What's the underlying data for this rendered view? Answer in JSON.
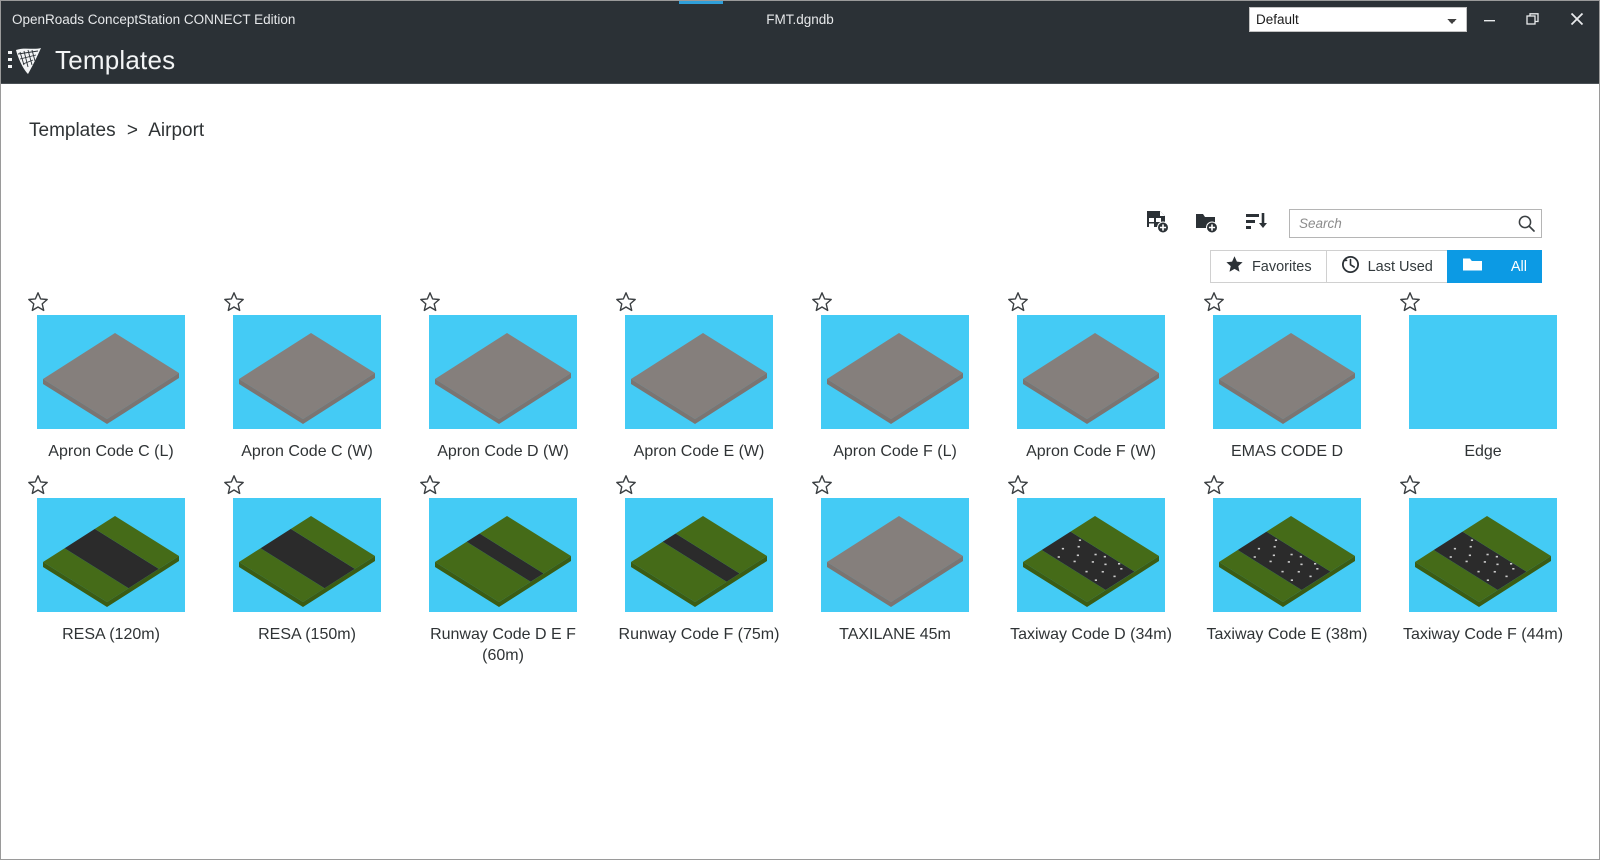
{
  "titlebar": {
    "app_name": "OpenRoads ConceptStation CONNECT Edition",
    "document_name": "FMT.dgndb",
    "profile_selected": "Default",
    "profile_options": [
      "Default"
    ],
    "minimize_label": "Minimize",
    "restore_label": "Restore",
    "close_label": "Close",
    "accent_color": "#2f9fda",
    "background_color": "#2b3136"
  },
  "header": {
    "title": "Templates",
    "logo_icon": "template-flag-icon"
  },
  "breadcrumb": {
    "root": "Templates",
    "separator": ">",
    "current": "Airport"
  },
  "toolbar": {
    "icons": [
      {
        "name": "new-template-icon",
        "title": "New Template"
      },
      {
        "name": "new-folder-icon",
        "title": "New Folder"
      },
      {
        "name": "sort-descending-icon",
        "title": "Sort"
      },
      {
        "name": "list-view-icon",
        "title": "List View"
      }
    ]
  },
  "search": {
    "placeholder": "Search",
    "value": "",
    "icon": "search-icon"
  },
  "filters": {
    "items": [
      {
        "label": "Favorites",
        "icon": "star-filled-icon",
        "active": false
      },
      {
        "label": "Last Used",
        "icon": "history-clock-icon",
        "active": false
      },
      {
        "label": "All",
        "icon": "folder-icon",
        "active": true
      }
    ],
    "active_color": "#0c9ae4"
  },
  "colors": {
    "thumb_background": "#44cbf5",
    "pavement_gray": "#857f7c",
    "pavement_gray_dark": "#7b7471",
    "grass_green": "#456b18",
    "grass_green_dark": "#3b5c14",
    "asphalt": "#2b2b2b",
    "asphalt_dark": "#232323"
  },
  "tiles": [
    {
      "label": "Apron Code C (L)",
      "favorite": false,
      "thumb": "apron",
      "row": 1
    },
    {
      "label": "Apron Code C (W)",
      "favorite": false,
      "thumb": "apron",
      "row": 1
    },
    {
      "label": "Apron Code D (W)",
      "favorite": false,
      "thumb": "apron",
      "row": 1
    },
    {
      "label": "Apron Code E (W)",
      "favorite": false,
      "thumb": "apron",
      "row": 1
    },
    {
      "label": "Apron Code F (L)",
      "favorite": false,
      "thumb": "apron",
      "row": 1
    },
    {
      "label": "Apron Code F (W)",
      "favorite": false,
      "thumb": "apron",
      "row": 1
    },
    {
      "label": "EMAS CODE D",
      "favorite": false,
      "thumb": "apron",
      "row": 1
    },
    {
      "label": "Edge",
      "favorite": false,
      "thumb": "empty",
      "row": 1
    },
    {
      "label": "RESA (120m)",
      "favorite": false,
      "thumb": "resa",
      "row": 1
    },
    {
      "label": "RESA (150m)",
      "favorite": false,
      "thumb": "resa",
      "row": 2
    },
    {
      "label": "Runway Code D E F (60m)",
      "favorite": false,
      "thumb": "runway",
      "row": 2
    },
    {
      "label": "Runway Code F (75m)",
      "favorite": false,
      "thumb": "runway",
      "row": 2
    },
    {
      "label": "TAXILANE 45m",
      "favorite": false,
      "thumb": "apron",
      "row": 2
    },
    {
      "label": "Taxiway Code D (34m)",
      "favorite": false,
      "thumb": "taxiway",
      "row": 2
    },
    {
      "label": "Taxiway Code E (38m)",
      "favorite": false,
      "thumb": "taxiway",
      "row": 2
    },
    {
      "label": "Taxiway Code F (44m)",
      "favorite": false,
      "thumb": "taxiway",
      "row": 2
    }
  ]
}
